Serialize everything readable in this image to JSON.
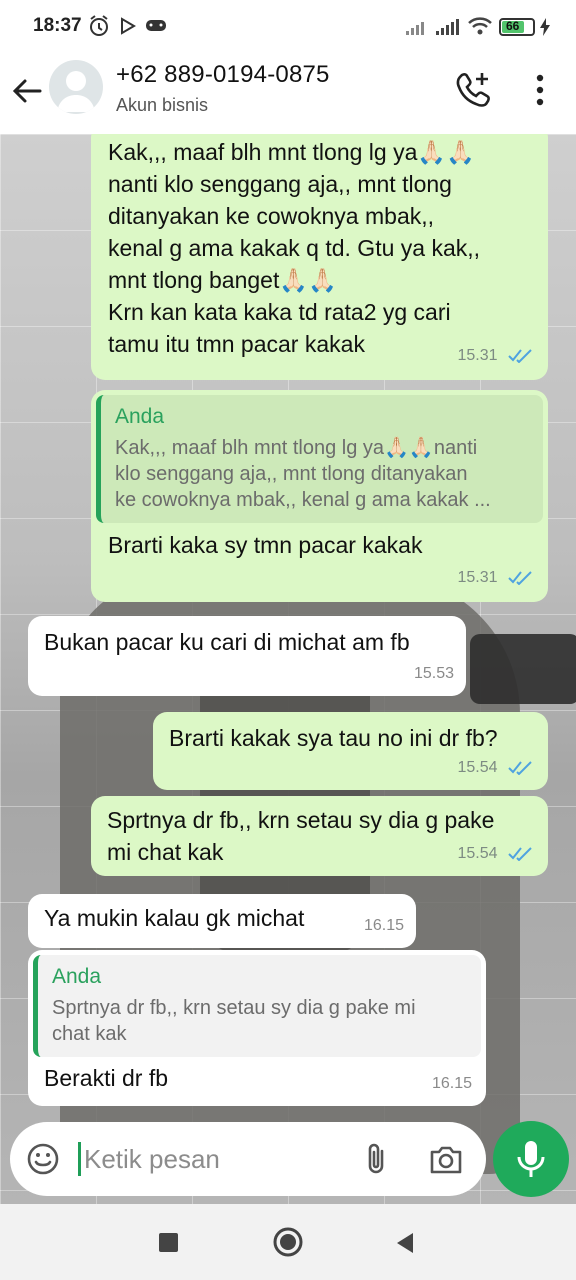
{
  "status": {
    "time": "18:37",
    "battery": "66",
    "icons": [
      "alarm-icon",
      "play-icon",
      "gamepad-icon",
      "signal-icon",
      "signal-icon",
      "wifi-icon",
      "battery-icon",
      "charging-icon"
    ]
  },
  "header": {
    "name": "+62 889-0194-0875",
    "subtitle": "Akun bisnis",
    "icons": [
      "back-arrow-icon",
      "avatar",
      "add-call-icon",
      "more-vert-icon"
    ]
  },
  "messages": [
    {
      "dir": "out",
      "text": "Kak,,, maaf blh mnt tlong lg ya🙏🏻🙏🏻\nnanti klo senggang aja,, mnt tlong\nditanyakan ke cowoknya mbak,,\nkenal g ama kakak q td. Gtu ya kak,,\nmnt tlong banget🙏🏻🙏🏻\nKrn kan kata kaka td rata2 yg cari\ntamu itu tmn pacar kakak",
      "time": "15.31",
      "read": true
    },
    {
      "dir": "out",
      "quote_author": "Anda",
      "quote_text": "Kak,,, maaf blh mnt tlong lg ya🙏🏻🙏🏻nanti\nklo senggang aja,, mnt tlong ditanyakan\nke cowoknya mbak,, kenal g ama kakak ...",
      "text": "Brarti kaka sy tmn pacar kakak",
      "time": "15.31",
      "read": true
    },
    {
      "dir": "in",
      "text": "Bukan pacar ku cari di michat am fb",
      "time": "15.53"
    },
    {
      "dir": "out",
      "text": "Brarti kakak sya tau no ini dr fb?",
      "time": "15.54",
      "read": true
    },
    {
      "dir": "out",
      "text": "Sprtnya dr fb,, krn setau sy dia g pake\nmi chat kak",
      "time": "15.54",
      "read": true
    },
    {
      "dir": "in",
      "text": "Ya mukin kalau gk michat",
      "time": "16.15"
    },
    {
      "dir": "in",
      "quote_author": "Anda",
      "quote_text": "Sprtnya dr fb,, krn setau sy dia g pake mi\nchat kak",
      "text": "Berakti dr fb",
      "time": "16.15"
    }
  ],
  "input": {
    "placeholder": "Ketik pesan",
    "icons": [
      "emoji-icon",
      "attach-icon",
      "camera-icon",
      "mic-icon"
    ]
  },
  "nav": {
    "icons": [
      "recents-icon",
      "home-icon",
      "back-icon"
    ]
  },
  "colors": {
    "outgoing": "#dcf8c6",
    "incoming": "#ffffff",
    "accent": "#1faa5b",
    "read_ticks": "#4fa3e0"
  }
}
